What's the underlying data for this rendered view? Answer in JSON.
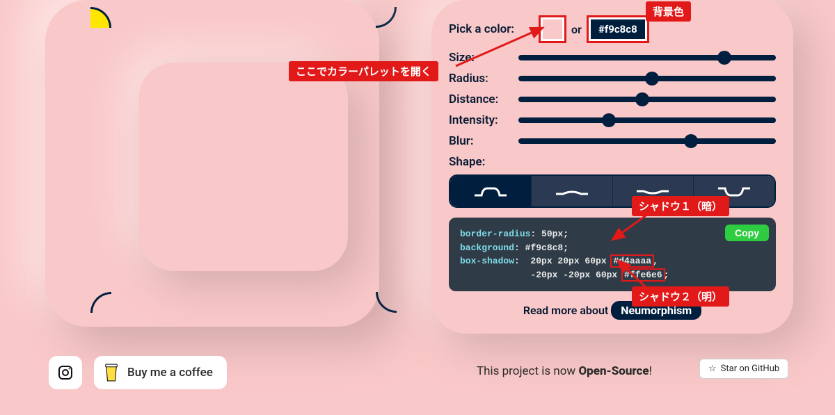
{
  "colorPicker": {
    "pick_label": "Pick a color:",
    "or_label": "or",
    "hex_value": "#f9c8c8"
  },
  "sliders": {
    "size": {
      "label": "Size:",
      "pct": 80
    },
    "radius": {
      "label": "Radius:",
      "pct": 52
    },
    "distance": {
      "label": "Distance:",
      "pct": 48
    },
    "intensity": {
      "label": "Intensity:",
      "pct": 35
    },
    "blur": {
      "label": "Blur:",
      "pct": 67
    }
  },
  "shape": {
    "label": "Shape:"
  },
  "code": {
    "prop_radius": "border-radius",
    "val_radius": ": 50px;",
    "prop_bg": "background",
    "val_bg": ": #f9c8c8;",
    "prop_shadow": "box-shadow",
    "val_shadow_prefix": ":  20px 20px 60px ",
    "val_shadow1_hex": "#d4aaaa",
    "val_shadow1_tail": ",",
    "val_shadow_line2_prefix": "             -20px -20px 60px ",
    "val_shadow2_hex": "#ffe6e6",
    "val_shadow2_tail": ";",
    "copy_label": "Copy"
  },
  "readmore": {
    "prefix": "Read more about ",
    "link": "Neumorphism"
  },
  "footer": {
    "coffee": "Buy me a coffee",
    "open_source_pre": "This project is now ",
    "open_source_bold": "Open-Source",
    "open_source_tail": "!",
    "github": "Star on GitHub"
  },
  "annotations": {
    "bg": "背景色",
    "open_palette": "ここでカラーパレットを開く",
    "shadow1": "シャドウ１（暗）",
    "shadow2": "シャドウ２（明）"
  }
}
